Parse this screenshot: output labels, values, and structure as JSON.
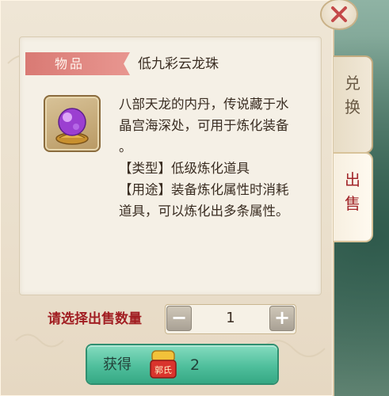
{
  "item": {
    "category_tag": "物品",
    "name": "低九彩云龙珠",
    "description_lines": [
      "八部天龙的内丹，传说藏于水",
      "晶宫海深处，可用于炼化装备",
      "。",
      "【类型】低级炼化道具",
      "【用途】装备炼化属性时消耗",
      "道具，可以炼化出多条属性。"
    ],
    "icon": "purple-dragon-pearl-icon"
  },
  "tabs": [
    {
      "label_line1": "兑",
      "label_line2": "换",
      "active": false
    },
    {
      "label_line1": "出",
      "label_line2": "售",
      "active": true
    }
  ],
  "quantity": {
    "label": "请选择出售数量",
    "value": "1",
    "minus_symbol": "−",
    "plus_symbol": "+"
  },
  "reward": {
    "label": "获得",
    "currency_icon": "coin-icon",
    "currency_text": "郭氏",
    "value": "2"
  },
  "colors": {
    "tag": "#e08a84",
    "quantity_label": "#a11e22",
    "obtain_bar": "#4fbf9c",
    "active_tab_text": "#a2262a"
  }
}
